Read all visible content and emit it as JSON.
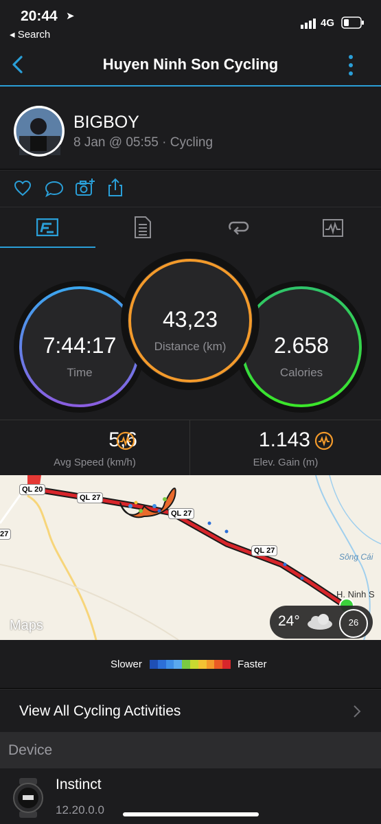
{
  "status_bar": {
    "time": "20:44",
    "back_app": "◂ Search",
    "network": "4G"
  },
  "nav": {
    "title": "Huyen Ninh Son Cycling"
  },
  "profile": {
    "name": "BIGBOY",
    "subtitle": "8 Jan @ 05:55 · Cycling"
  },
  "rings": {
    "time": {
      "value": "7:44:17",
      "label": "Time"
    },
    "distance": {
      "value": "43,23",
      "label": "Distance (km)"
    },
    "calories": {
      "value": "2.658",
      "label": "Calories"
    }
  },
  "metrics": [
    {
      "value": "5,6",
      "label": "Avg Speed (km/h)"
    },
    {
      "value": "1.143",
      "label": "Elev. Gain (m)"
    }
  ],
  "map": {
    "road_labels": [
      "QL 20",
      "QL 27",
      "QL 27",
      "QL 27",
      "27"
    ],
    "place_labels": [
      "Sông Cái",
      "H. Ninh S"
    ],
    "attribution": "Maps",
    "temperature": "24°",
    "compass_value": "26"
  },
  "legend": {
    "slower": "Slower",
    "faster": "Faster",
    "colors": [
      "#1f4fb5",
      "#2c6fd8",
      "#3f8fe8",
      "#5aa9ef",
      "#7ac943",
      "#c9d930",
      "#f3c233",
      "#f39a2b",
      "#ea5a24",
      "#d8262b"
    ]
  },
  "view_all": {
    "label": "View All Cycling Activities"
  },
  "device": {
    "header": "Device",
    "name": "Instinct",
    "version": "12.20.0.0"
  },
  "colors": {
    "accent": "#2a9fd8",
    "time_ring": "#6e7fe0",
    "distance_ring": "#f39a2b",
    "calories_ring": "#3bd33b"
  }
}
